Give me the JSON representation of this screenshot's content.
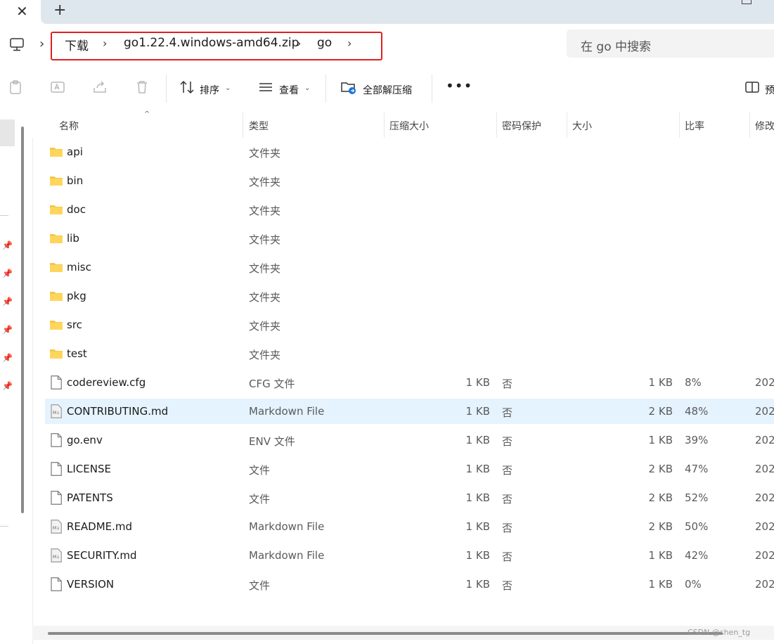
{
  "tabbar": {
    "close_glyph": "✕",
    "add_glyph": "+"
  },
  "address": {
    "pc_icon": "computer-icon",
    "crumbs": [
      {
        "label": "下载"
      },
      {
        "label": "go1.22.4.windows-amd64.zip"
      },
      {
        "label": "go"
      }
    ],
    "sep_glyph": "›",
    "search_placeholder": "在 go 中搜索",
    "highlight_color": "#e02020"
  },
  "toolbar": {
    "sort_label": "排序",
    "view_label": "查看",
    "extract_label": "全部解压缩",
    "more_glyph": "•••",
    "preview_label": "预"
  },
  "columns": {
    "name": "名称",
    "type": "类型",
    "compressed_size": "压缩大小",
    "password": "密码保护",
    "size": "大小",
    "ratio": "比率",
    "modified": "修改"
  },
  "rows": [
    {
      "name": "api",
      "icon": "folder-icon",
      "type": "文件夹",
      "csize": "",
      "enc": "",
      "size": "",
      "ratio": "",
      "mod": ""
    },
    {
      "name": "bin",
      "icon": "folder-icon",
      "type": "文件夹",
      "csize": "",
      "enc": "",
      "size": "",
      "ratio": "",
      "mod": ""
    },
    {
      "name": "doc",
      "icon": "folder-icon",
      "type": "文件夹",
      "csize": "",
      "enc": "",
      "size": "",
      "ratio": "",
      "mod": ""
    },
    {
      "name": "lib",
      "icon": "folder-icon",
      "type": "文件夹",
      "csize": "",
      "enc": "",
      "size": "",
      "ratio": "",
      "mod": ""
    },
    {
      "name": "misc",
      "icon": "folder-icon",
      "type": "文件夹",
      "csize": "",
      "enc": "",
      "size": "",
      "ratio": "",
      "mod": ""
    },
    {
      "name": "pkg",
      "icon": "folder-icon",
      "type": "文件夹",
      "csize": "",
      "enc": "",
      "size": "",
      "ratio": "",
      "mod": ""
    },
    {
      "name": "src",
      "icon": "folder-icon",
      "type": "文件夹",
      "csize": "",
      "enc": "",
      "size": "",
      "ratio": "",
      "mod": ""
    },
    {
      "name": "test",
      "icon": "folder-icon",
      "type": "文件夹",
      "csize": "",
      "enc": "",
      "size": "",
      "ratio": "",
      "mod": ""
    },
    {
      "name": "codereview.cfg",
      "icon": "file-icon",
      "type": "CFG 文件",
      "csize": "1 KB",
      "enc": "否",
      "size": "1 KB",
      "ratio": "8%",
      "mod": "202"
    },
    {
      "name": "CONTRIBUTING.md",
      "icon": "markdown-file-icon",
      "type": "Markdown File",
      "csize": "1 KB",
      "enc": "否",
      "size": "2 KB",
      "ratio": "48%",
      "mod": "202",
      "selected": true
    },
    {
      "name": "go.env",
      "icon": "file-icon",
      "type": "ENV 文件",
      "csize": "1 KB",
      "enc": "否",
      "size": "1 KB",
      "ratio": "39%",
      "mod": "202"
    },
    {
      "name": "LICENSE",
      "icon": "file-icon",
      "type": "文件",
      "csize": "1 KB",
      "enc": "否",
      "size": "2 KB",
      "ratio": "47%",
      "mod": "202"
    },
    {
      "name": "PATENTS",
      "icon": "file-icon",
      "type": "文件",
      "csize": "1 KB",
      "enc": "否",
      "size": "2 KB",
      "ratio": "52%",
      "mod": "202"
    },
    {
      "name": "README.md",
      "icon": "markdown-file-icon",
      "type": "Markdown File",
      "csize": "1 KB",
      "enc": "否",
      "size": "2 KB",
      "ratio": "50%",
      "mod": "202"
    },
    {
      "name": "SECURITY.md",
      "icon": "markdown-file-icon",
      "type": "Markdown File",
      "csize": "1 KB",
      "enc": "否",
      "size": "1 KB",
      "ratio": "42%",
      "mod": "202"
    },
    {
      "name": "VERSION",
      "icon": "file-icon",
      "type": "文件",
      "csize": "1 KB",
      "enc": "否",
      "size": "1 KB",
      "ratio": "0%",
      "mod": "202"
    }
  ],
  "watermark": "CSDN @shen_tg",
  "colors": {
    "folder": "#f4c74a",
    "selected_row": "#e5f3ff"
  }
}
